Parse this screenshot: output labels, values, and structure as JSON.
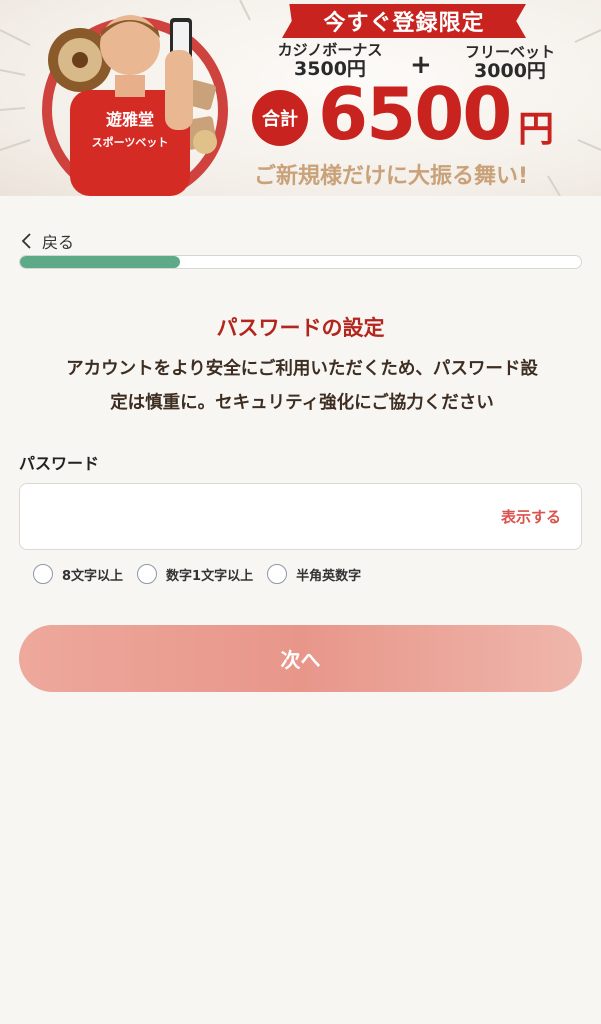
{
  "banner": {
    "ribbon": "今すぐ登録限定",
    "casino_label": "カジノボーナス",
    "casino_amount": "3500円",
    "plus": "+",
    "free_label": "フリーベット",
    "free_amount": "3000円",
    "total_badge": "合計",
    "total_amount": "6500",
    "total_unit": "円",
    "tagline": "ご新規様だけに大振る舞い!",
    "shirt_text_1": "遊雅堂",
    "shirt_text_2": "スポーツベット"
  },
  "nav": {
    "back_label": "戻る"
  },
  "progress": {
    "fraction": 0.285
  },
  "page": {
    "title": "パスワードの設定",
    "description_line1": "アカウントをより安全にご利用いただくため、パスワード設",
    "description_line2": "定は慎重に。セキュリティ強化にご協力ください"
  },
  "password": {
    "label": "パスワード",
    "value": "",
    "placeholder": "",
    "toggle_label": "表示する"
  },
  "rules": [
    {
      "label": "8文字以上",
      "checked": false
    },
    {
      "label": "数字1文字以上",
      "checked": false
    },
    {
      "label": "半角英数字",
      "checked": false
    }
  ],
  "next_button": {
    "label": "次へ"
  },
  "colors": {
    "accent_red": "#b3261e",
    "progress_green": "#5ea987",
    "button_salmon": "#e8968a",
    "link_red": "#d9534f"
  }
}
